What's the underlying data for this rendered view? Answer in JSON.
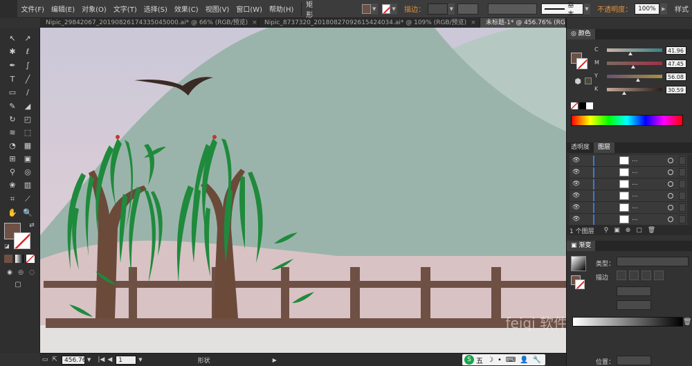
{
  "menu": {
    "items": [
      "文件(F)",
      "编辑(E)",
      "对象(O)",
      "文字(T)",
      "选择(S)",
      "效果(C)",
      "视图(V)",
      "窗口(W)",
      "帮助(H)"
    ],
    "shape_name": "矩形",
    "stroke_label": "描边：",
    "stroke_style": "基本",
    "opacity_label": "不透明度：",
    "opacity_value": "100%",
    "style_label": "样式",
    "fill_color": "#6f5044"
  },
  "tabs": [
    {
      "label": "Nipic_29842067_20190826174335045000.ai* @ 66% (RGB/预览)",
      "close": "×"
    },
    {
      "label": "Nipic_8737320_20180827092615424034.ai* @ 109% (RGB/预览)",
      "close": "×"
    },
    {
      "label": "未标题-1* @ 456.76% (RGB/预览)",
      "close": "×"
    }
  ],
  "color_panel": {
    "title": "颜色",
    "channels": [
      {
        "label": "C",
        "value": "41.96",
        "pos": 0.42
      },
      {
        "label": "M",
        "value": "47.45",
        "pos": 0.47
      },
      {
        "label": "Y",
        "value": "56.08",
        "pos": 0.56
      },
      {
        "label": "K",
        "value": "30.59",
        "pos": 0.31
      }
    ]
  },
  "layers_panel": {
    "tabs": [
      "透明度",
      "图层"
    ],
    "rows": [
      {
        "dots": "..."
      },
      {
        "dots": "..."
      },
      {
        "dots": "..."
      },
      {
        "dots": "..."
      },
      {
        "dots": "..."
      },
      {
        "dots": "..."
      }
    ],
    "count": "1 个图层"
  },
  "gradient_panel": {
    "title": "渐变",
    "type_label": "类型：",
    "stroke_label": "描边",
    "position_label": "位置："
  },
  "status": {
    "zoom": "456.76",
    "page": "1",
    "tool_name": "形状"
  },
  "ime": {
    "items": [
      "五",
      "☽",
      "•",
      "⌨",
      "👤",
      "🔧"
    ]
  },
  "watermark": "feiqi 软件"
}
